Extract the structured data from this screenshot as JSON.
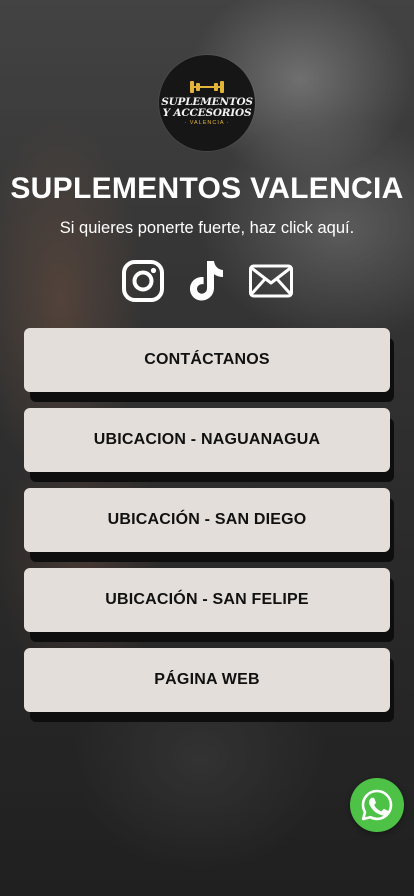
{
  "logo": {
    "line1": "SUPLEMENTOS",
    "line2": "Y ACCESORIOS",
    "line3": "· VALENCIA ·"
  },
  "profile": {
    "title": "SUPLEMENTOS VALENCIA",
    "subtitle": "Si quieres ponerte fuerte, haz click aquí."
  },
  "socials": [
    {
      "icon": "instagram-icon"
    },
    {
      "icon": "tiktok-icon"
    },
    {
      "icon": "email-icon"
    }
  ],
  "links": [
    {
      "label": "CONTÁCTANOS"
    },
    {
      "label": "UBICACION - NAGUANAGUA"
    },
    {
      "label": "UBICACIÓN - SAN DIEGO"
    },
    {
      "label": "UBICACIÓN - SAN FELIPE"
    },
    {
      "label": "PÁGINA WEB"
    }
  ],
  "colors": {
    "button_bg": "#e3ded9",
    "button_text": "#111111",
    "button_shadow": "#0e0e0e",
    "whatsapp": "#4dc247",
    "logo_gold": "#e3b43a"
  },
  "floating": {
    "icon": "whatsapp-icon"
  }
}
